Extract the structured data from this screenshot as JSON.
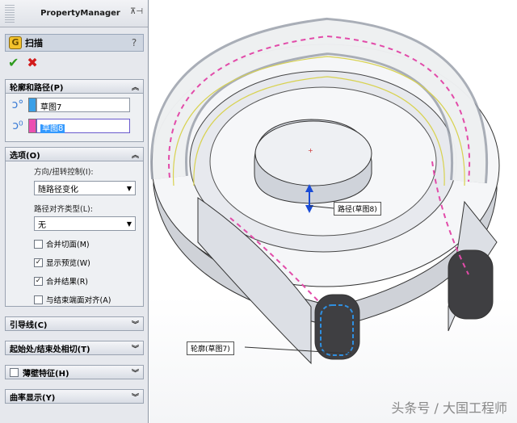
{
  "panel": {
    "title": "PropertyManager",
    "pin_glyphs": "⊼⊣"
  },
  "feature": {
    "title": "扫描",
    "help": "?"
  },
  "actions": {
    "ok": "✔",
    "cancel": "✖"
  },
  "profile_path": {
    "header": "轮廓和路径(P)",
    "profile": {
      "value": "草图7",
      "swatch_color": "#3aa0e8"
    },
    "path": {
      "value": "草图8",
      "swatch_color": "#ec4fb2"
    }
  },
  "options": {
    "header": "选项(O)",
    "orientation_label": "方向/扭转控制(I):",
    "orientation_value": "随路径变化",
    "path_align_label": "路径对齐类型(L):",
    "path_align_value": "无",
    "checkboxes": [
      {
        "label": "合并切面(M)",
        "checked": false,
        "mark": ""
      },
      {
        "label": "显示预览(W)",
        "checked": true,
        "mark": "✓"
      },
      {
        "label": "合并结果(R)",
        "checked": true,
        "mark": "✓"
      },
      {
        "label": "与结束端面对齐(A)",
        "checked": false,
        "mark": ""
      }
    ]
  },
  "collapsed_groups": {
    "guide_curves": "引导线(C)",
    "tangency": "起始处/结束处相切(T)",
    "thin_feature": "薄壁特征(H)",
    "curvature": "曲率显示(Y)"
  },
  "viewport": {
    "callout_path": "路径(草图8)",
    "callout_profile": "轮廓(草图7)",
    "watermark": "头条号 / 大国工程师"
  }
}
